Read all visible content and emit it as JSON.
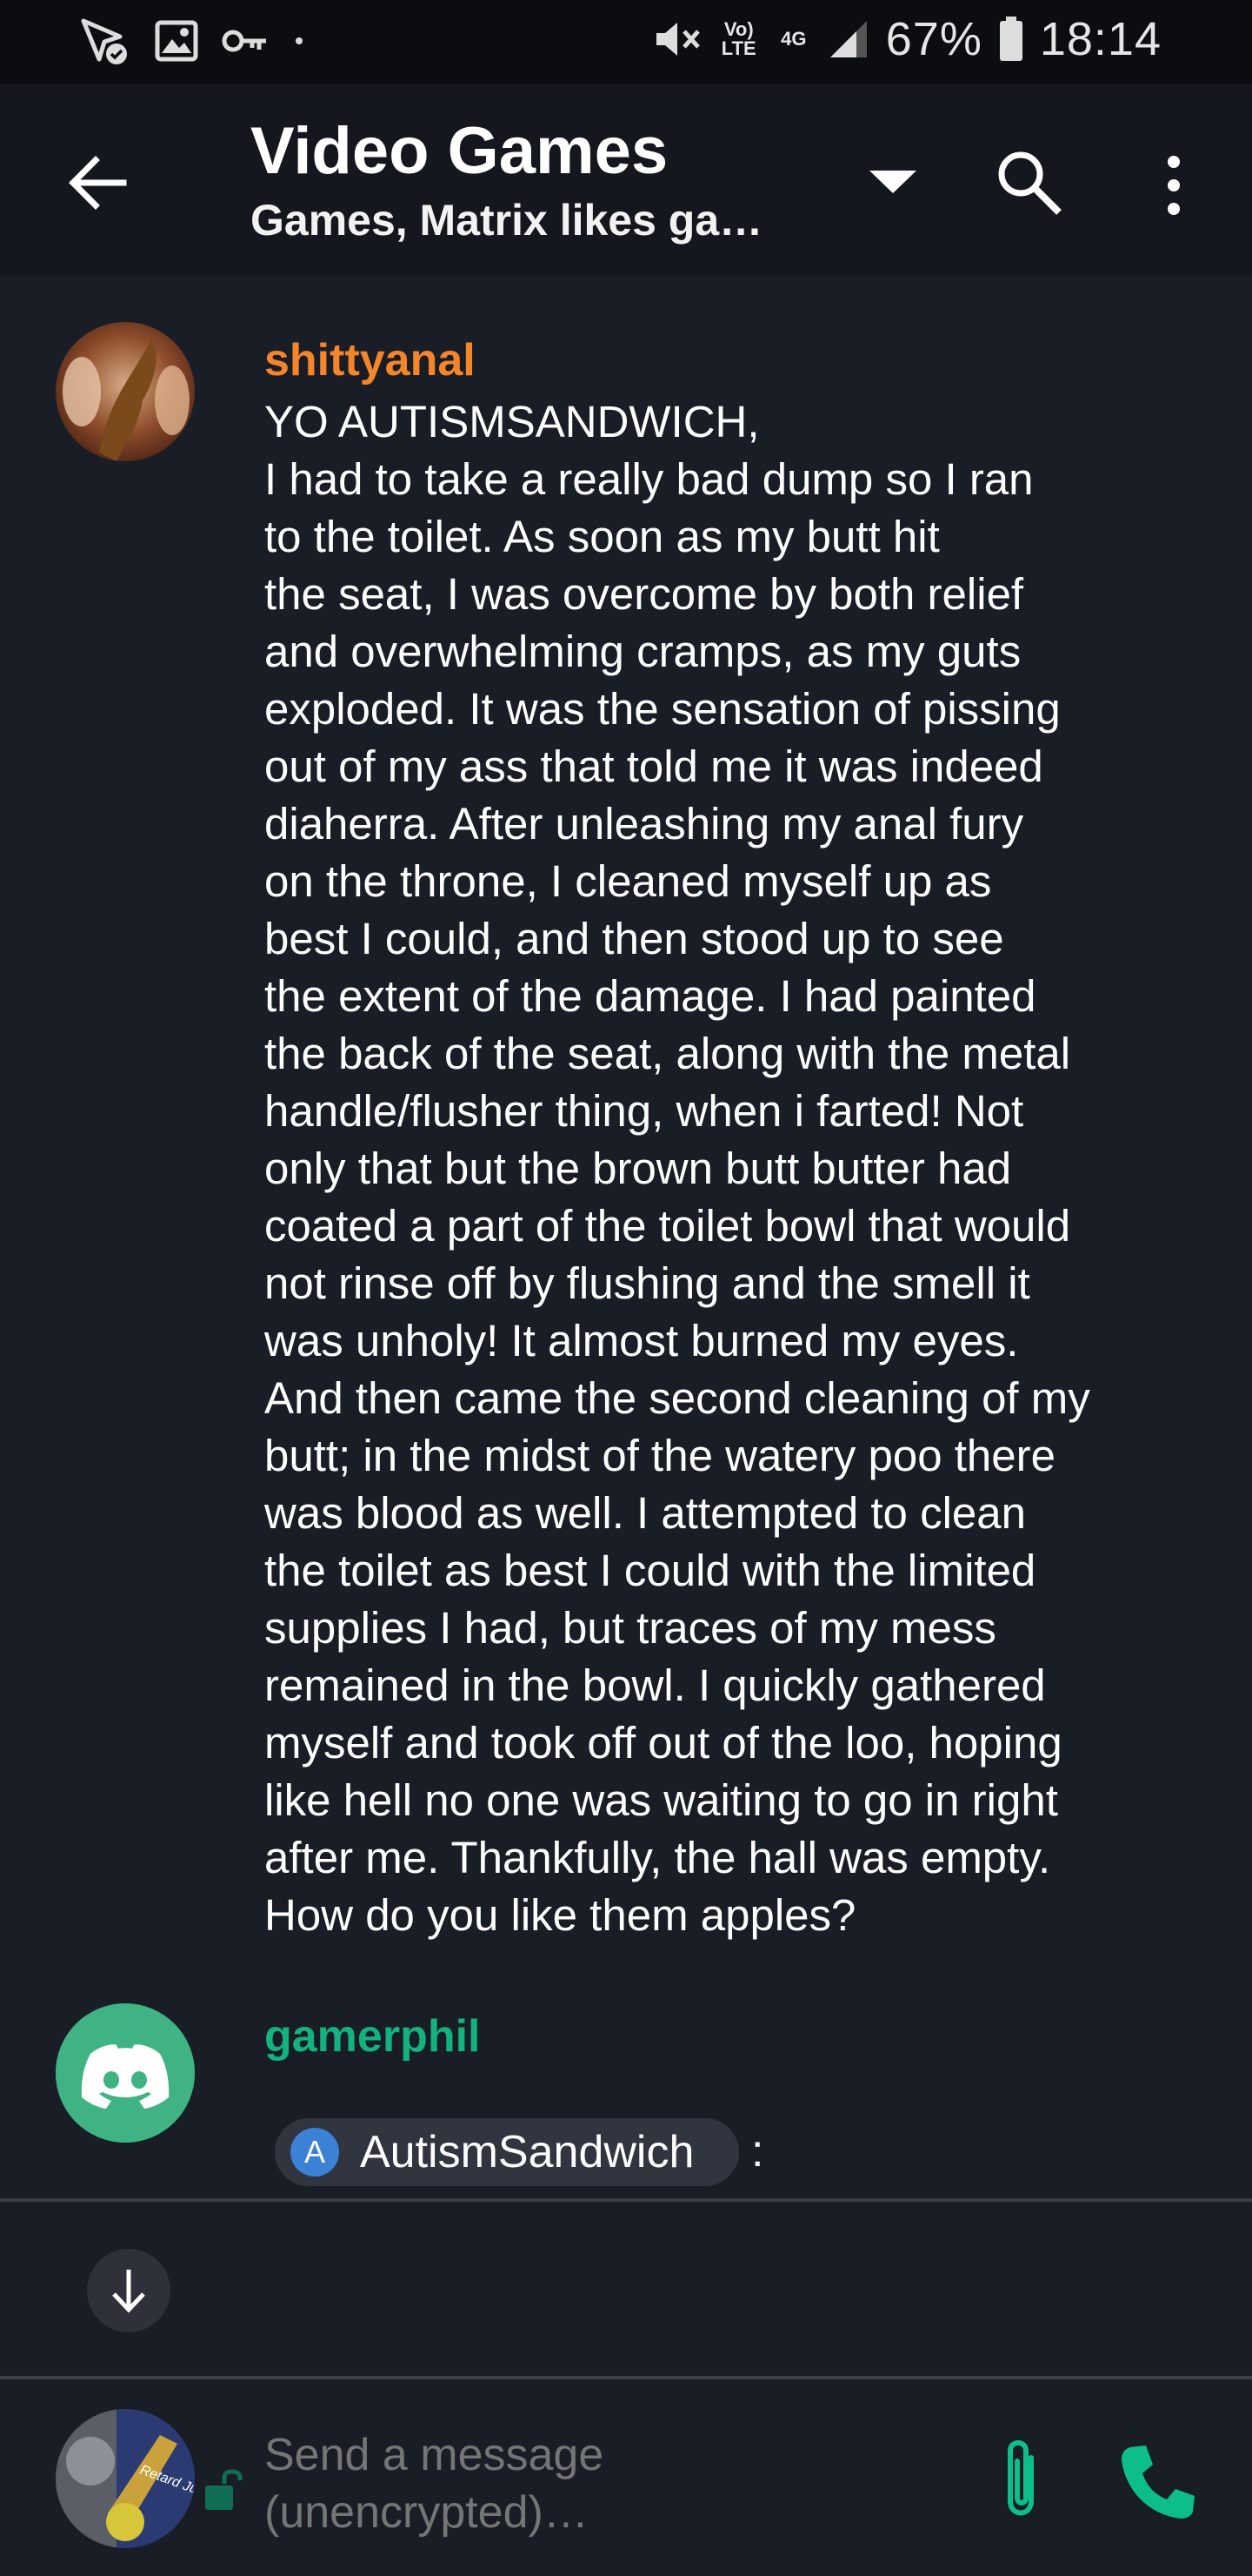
{
  "status_bar": {
    "left_icons": [
      "location-check-icon",
      "image-icon",
      "key-icon",
      "dot-icon"
    ],
    "right_icons": [
      "mute-icon",
      "volte-icon",
      "4g-icon",
      "signal-icon"
    ],
    "volte_label": "Vo) LTE",
    "network_label": "4G",
    "battery": "67%",
    "time": "18:14"
  },
  "app_bar": {
    "title": "Video Games",
    "topic": "Games, Matrix likes ga…"
  },
  "messages": [
    {
      "sender": "shittyanal",
      "sender_color": "#f5852a",
      "body": "YO AUTISMSANDWICH,\nI had to take a really bad dump so I ran\nto the toilet. As soon as my butt hit\nthe seat, I was overcome by both relief\nand overwhelming cramps, as my guts\nexploded. It was the sensation of pissing\nout of my ass that told me it was indeed\ndiaherra. After unleashing my anal fury\non the throne, I cleaned myself up as\nbest I could, and then stood up to see\nthe extent of the damage. I had painted\nthe back of the seat, along with the metal\nhandle/flusher thing, when i farted! Not\nonly that but the brown butt butter had\ncoated a part of the toilet bowl that would\nnot rinse off by flushing and the smell it\nwas unholy! It almost burned my eyes.\nAnd then came the second cleaning of my\nbutt; in the midst of the watery poo there\nwas blood as well. I attempted to clean\nthe toilet as best I could with the limited\nsupplies I had, but traces of my mess\nremained in the bowl. I quickly gathered\nmyself and took off out of the loo, hoping\nlike hell no one was waiting to go in right\nafter me. Thankfully, the hall was empty.\nHow do you like them apples?"
    },
    {
      "sender": "gamerphil",
      "sender_color": "#14b27e",
      "mention_initial": "A",
      "mention": "AutismSandwich",
      "suffix": ":"
    }
  ],
  "composer": {
    "placeholder": "Send a message\n(unencrypted)…",
    "avatar_text": "Retard Juice"
  },
  "colors": {
    "background": "#181d26",
    "accent": "#0dbd8b"
  }
}
